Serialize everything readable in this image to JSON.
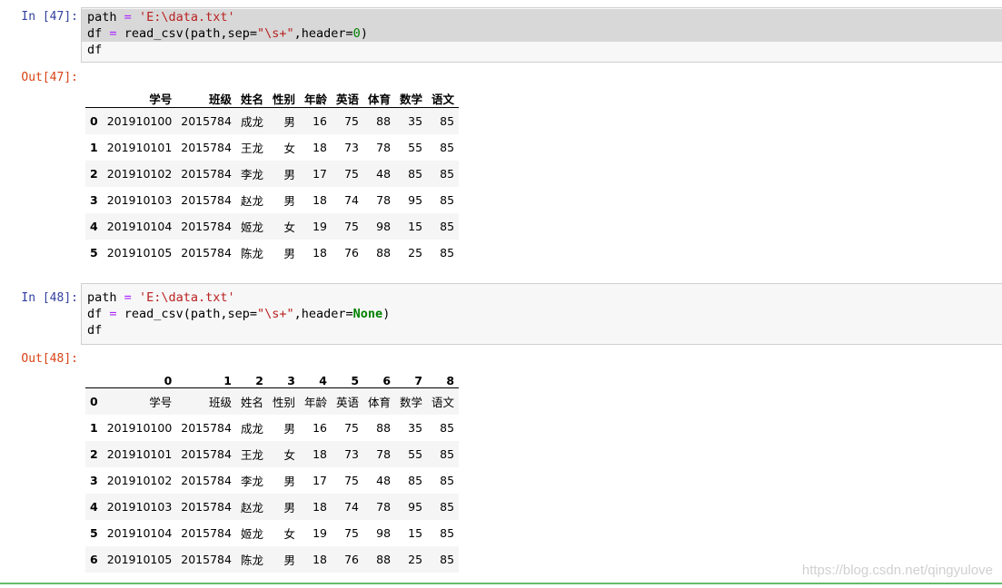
{
  "cells": [
    {
      "in_prompt": "In [47]:",
      "code": {
        "path_var": "path",
        "eq": "=",
        "path_str": "'E:\\data.txt'",
        "df_var": "df",
        "func": "read_csv(path,sep=",
        "sep_str": "\"\\s+\"",
        "header_kw": ",header=",
        "header_val": "0",
        "close": ")",
        "last_line": "df"
      },
      "out_prompt": "Out[47]:",
      "table": {
        "columns": [
          "",
          "学号",
          "班级",
          "姓名",
          "性别",
          "年龄",
          "英语",
          "体育",
          "数学",
          "语文"
        ],
        "rows": [
          [
            "0",
            "201910100",
            "2015784",
            "成龙",
            "男",
            "16",
            "75",
            "88",
            "35",
            "85"
          ],
          [
            "1",
            "201910101",
            "2015784",
            "王龙",
            "女",
            "18",
            "73",
            "78",
            "55",
            "85"
          ],
          [
            "2",
            "201910102",
            "2015784",
            "李龙",
            "男",
            "17",
            "75",
            "48",
            "85",
            "85"
          ],
          [
            "3",
            "201910103",
            "2015784",
            "赵龙",
            "男",
            "18",
            "74",
            "78",
            "95",
            "85"
          ],
          [
            "4",
            "201910104",
            "2015784",
            "姬龙",
            "女",
            "19",
            "75",
            "98",
            "15",
            "85"
          ],
          [
            "5",
            "201910105",
            "2015784",
            "陈龙",
            "男",
            "18",
            "76",
            "88",
            "25",
            "85"
          ]
        ]
      }
    },
    {
      "in_prompt": "In [48]:",
      "code": {
        "path_var": "path",
        "eq": "=",
        "path_str": "'E:\\data.txt'",
        "df_var": "df",
        "func": "read_csv(path,sep=",
        "sep_str": "\"\\s+\"",
        "header_kw": ",header=",
        "header_val": "None",
        "close": ")",
        "last_line": "df"
      },
      "out_prompt": "Out[48]:",
      "table": {
        "columns": [
          "",
          "0",
          "1",
          "2",
          "3",
          "4",
          "5",
          "6",
          "7",
          "8"
        ],
        "rows": [
          [
            "0",
            "学号",
            "班级",
            "姓名",
            "性别",
            "年龄",
            "英语",
            "体育",
            "数学",
            "语文"
          ],
          [
            "1",
            "201910100",
            "2015784",
            "成龙",
            "男",
            "16",
            "75",
            "88",
            "35",
            "85"
          ],
          [
            "2",
            "201910101",
            "2015784",
            "王龙",
            "女",
            "18",
            "73",
            "78",
            "55",
            "85"
          ],
          [
            "3",
            "201910102",
            "2015784",
            "李龙",
            "男",
            "17",
            "75",
            "48",
            "85",
            "85"
          ],
          [
            "4",
            "201910103",
            "2015784",
            "赵龙",
            "男",
            "18",
            "74",
            "78",
            "95",
            "85"
          ],
          [
            "5",
            "201910104",
            "2015784",
            "姬龙",
            "女",
            "19",
            "75",
            "98",
            "15",
            "85"
          ],
          [
            "6",
            "201910105",
            "2015784",
            "陈龙",
            "男",
            "18",
            "76",
            "88",
            "25",
            "85"
          ]
        ]
      }
    }
  ],
  "watermark": "https://blog.csdn.net/qingyulove",
  "colors": {
    "in_prompt": "#303f9f",
    "out_prompt": "#d84315",
    "string": "#ba2121",
    "operator": "#aa22ff",
    "keyword": "#008000",
    "selected_border": "#66bb6a"
  }
}
